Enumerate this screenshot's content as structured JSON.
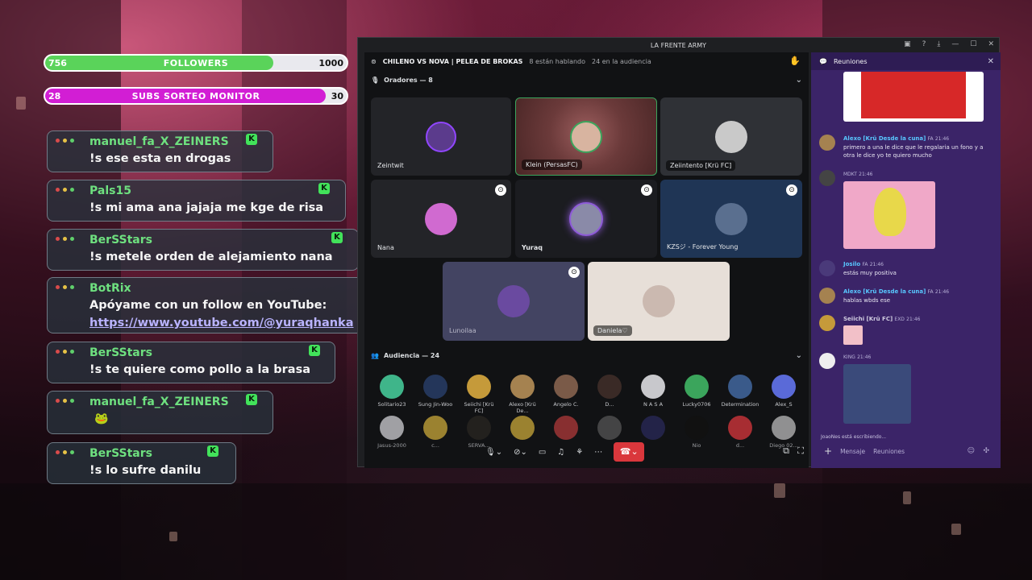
{
  "followers": {
    "current": "756",
    "label": "FOLLOWERS",
    "goal": "1000",
    "progress": 0.756,
    "color": "#5ad35a"
  },
  "subs": {
    "current": "28",
    "label": "SUBS SORTEO MONITOR",
    "goal": "30",
    "progress": 0.93,
    "color": "#d21ed4"
  },
  "chat": [
    {
      "user": "manuel_fa_X_ZEINERS",
      "message": "!s ese esta en drogas"
    },
    {
      "user": "Pals15",
      "message": "!s mi ama ana jajaja me kge de risa"
    },
    {
      "user": "BerSStars",
      "message": "!s metele orden de alejamiento nana"
    },
    {
      "user": "BotRix",
      "message": "Apóyame con un follow en YouTube:",
      "link": "https://www.youtube.com/@yuraqhanka"
    },
    {
      "user": "BerSStars",
      "message": "!s te quiere como pollo a la brasa"
    },
    {
      "user": "manuel_fa_X_ZEINERS",
      "message": ""
    },
    {
      "user": "BerSStars",
      "message": "!s lo sufre danilu"
    }
  ],
  "discord": {
    "window_title": "LA FRENTE ARMY",
    "stage_title": "CHILENO VS NOVA | PELEA DE BROKAS",
    "speaking": "8 están hablando",
    "audience_count": "24 en la audiencia",
    "speakers_header": "Oradores — 8",
    "audience_header": "Audiencia — 24",
    "speakers": [
      {
        "name": "Zeintwit"
      },
      {
        "name": "Klein (PersasFC)"
      },
      {
        "name": "Zeiintento [Krü FC]"
      },
      {
        "name": "Nana"
      },
      {
        "name": "Yuraq"
      },
      {
        "name": "KZSジ - Forever Young"
      },
      {
        "name": "Lunoilaa"
      },
      {
        "name": "Daniela♡"
      }
    ],
    "audience": [
      {
        "name": "Solitario23"
      },
      {
        "name": "Sung Jin-Woo"
      },
      {
        "name": "Seiichi [Krü FC]"
      },
      {
        "name": "Alexo [Krü De..."
      },
      {
        "name": "Angelo C."
      },
      {
        "name": "D..."
      },
      {
        "name": "N A S A"
      },
      {
        "name": "Lucky0706"
      },
      {
        "name": "Determination"
      },
      {
        "name": "Alex_S"
      },
      {
        "name": "Jasus-2000"
      },
      {
        "name": "c..."
      },
      {
        "name": "SERVA..."
      },
      {
        "name": ""
      },
      {
        "name": ""
      },
      {
        "name": ""
      },
      {
        "name": ""
      },
      {
        "name": "Nio"
      },
      {
        "name": "d..."
      },
      {
        "name": "Diego 02..."
      }
    ],
    "panel": {
      "title": "Reuniones",
      "messages": [
        {
          "user": "Alexo [Krü Desde la cuna]",
          "tag": "FA",
          "time": "21:46",
          "text": "primero a una le dice que le regalaria un fono y a otra le dice yo te quiero mucho"
        },
        {
          "user": "",
          "tag": "MDKT",
          "time": "21:46",
          "text": ""
        },
        {
          "user": "Josilo",
          "tag": "FA",
          "time": "21:46",
          "text": "estás muy positiva"
        },
        {
          "user": "Alexo [Krü Desde la cuna]",
          "tag": "FA",
          "time": "21:46",
          "text": "hablas wbds ese"
        },
        {
          "user": "Seiichi [Krü FC]",
          "tag": "EXD",
          "time": "21:46",
          "text": ""
        },
        {
          "user": "",
          "tag": "KING",
          "time": "21:46",
          "text": ""
        }
      ],
      "typing": "JoaoNes está escribiendo...",
      "input_placeholder": "Mensaje",
      "input_channel": "Reuniones"
    }
  }
}
